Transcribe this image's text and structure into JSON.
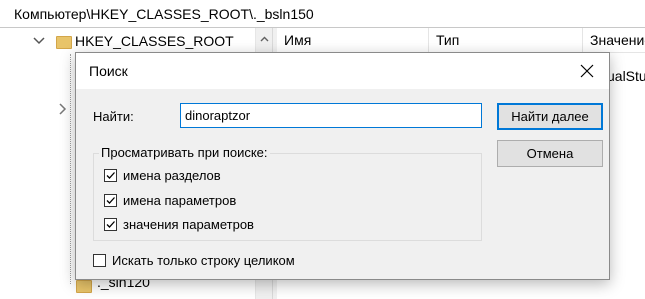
{
  "address_bar": {
    "path": "Компьютер\\HKEY_CLASSES_ROOT\\._bsln150"
  },
  "tree": {
    "root_label": "HKEY_CLASSES_ROOT",
    "last_visible_item": "._sln120"
  },
  "list": {
    "columns": [
      "Имя",
      "Тип",
      "Значение"
    ],
    "peek_text": "ualStu"
  },
  "dialog": {
    "title": "Поиск",
    "find_label": "Найти:",
    "find_value": "dinoraptzor",
    "find_next_button": "Найти далее",
    "cancel_button": "Отмена",
    "look_at_group_title": "Просматривать при поиске:",
    "options": [
      {
        "label": "имена разделов",
        "checked": true
      },
      {
        "label": "имена параметров",
        "checked": true
      },
      {
        "label": "значения параметров",
        "checked": true
      }
    ],
    "match_whole_string": {
      "label": "Искать только строку целиком",
      "checked": false
    }
  },
  "colors": {
    "accent": "#0078d7",
    "dialog_bg": "#f0f0f0",
    "folder": "#e8c46a"
  },
  "icons": {
    "close": "close-icon",
    "expand": "chevron-down-icon",
    "folder": "folder-icon",
    "scroll_up": "scroll-up-arrow-icon",
    "check": "check-icon"
  }
}
